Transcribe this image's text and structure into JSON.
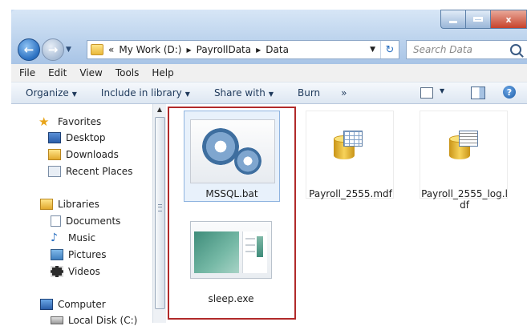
{
  "window": {
    "caption_buttons": {
      "minimize": "–",
      "maximize": "□",
      "close": "x"
    }
  },
  "address_bar": {
    "prefix": "«",
    "crumbs": [
      "My Work (D:)",
      "PayrollData",
      "Data"
    ]
  },
  "search": {
    "placeholder": "Search Data"
  },
  "menubar": {
    "items": [
      "File",
      "Edit",
      "View",
      "Tools",
      "Help"
    ]
  },
  "commandbar": {
    "organize": "Organize",
    "include": "Include in library",
    "share": "Share with",
    "burn": "Burn",
    "more": "»"
  },
  "sidebar": {
    "favorites": {
      "label": "Favorites",
      "items": [
        "Desktop",
        "Downloads",
        "Recent Places"
      ]
    },
    "libraries": {
      "label": "Libraries",
      "items": [
        "Documents",
        "Music",
        "Pictures",
        "Videos"
      ]
    },
    "computer": {
      "label": "Computer",
      "items": [
        "Local Disk (C:)"
      ]
    }
  },
  "files": [
    {
      "name": "MSSQL.bat",
      "icon": "batch-gears-icon",
      "highlighted": true
    },
    {
      "name": "Payroll_2555.mdf",
      "icon": "database-table-icon",
      "highlighted": false
    },
    {
      "name_line1": "Payroll_2555_log.l",
      "name_line2": "df",
      "icon": "database-log-icon",
      "highlighted": false
    },
    {
      "name": "sleep.exe",
      "icon": "exe-window-icon",
      "highlighted": true
    }
  ],
  "colors": {
    "highlight_border": "#b12a2a",
    "accent": "#2a6fc0"
  }
}
